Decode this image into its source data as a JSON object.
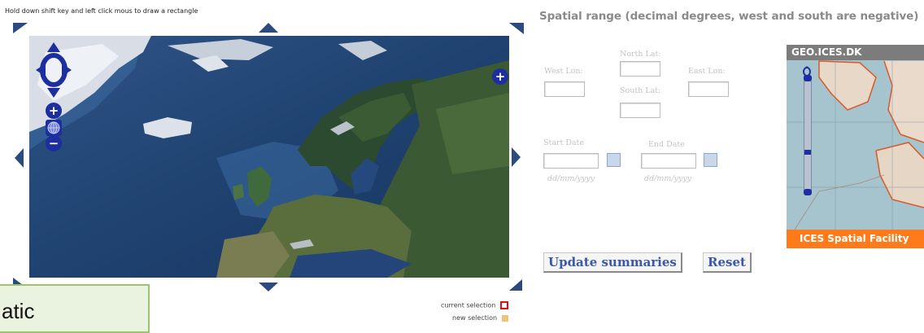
{
  "map": {
    "hint": "Hold down shift key and left click mous to draw a rectangle",
    "legend": {
      "current": "current selection",
      "new": "new selection",
      "current_color": "#e01010",
      "new_color": "#f2c27a"
    },
    "icons": [
      "pan-control-icon",
      "zoom-in-icon",
      "zoom-out-icon",
      "globe-icon",
      "layer-switcher-icon"
    ]
  },
  "form": {
    "title": "Spatial range (decimal degrees, west and south are negative)",
    "north_label": "North Lat:",
    "west_label": "West Lon:",
    "east_label": "East Lon:",
    "south_label": "South Lat:",
    "start_label": "Start Date",
    "end_label": "End Date",
    "start_format": "dd/mm/yyyy",
    "end_format": "dd/mm/yyyy",
    "update_button": "Update summaries",
    "reset_button": "Reset"
  },
  "mini_map": {
    "title": "GEO.ICES.DK",
    "footer": "ICES Spatial Facility",
    "header_color": "#7c7c7c",
    "footer_color": "#ff7a1a"
  },
  "callout": {
    "text": "atic"
  },
  "colors": {
    "button_text": "#3a59a8",
    "control_blue": "#1d2fa0",
    "label_gray": "#c3c3c3"
  }
}
